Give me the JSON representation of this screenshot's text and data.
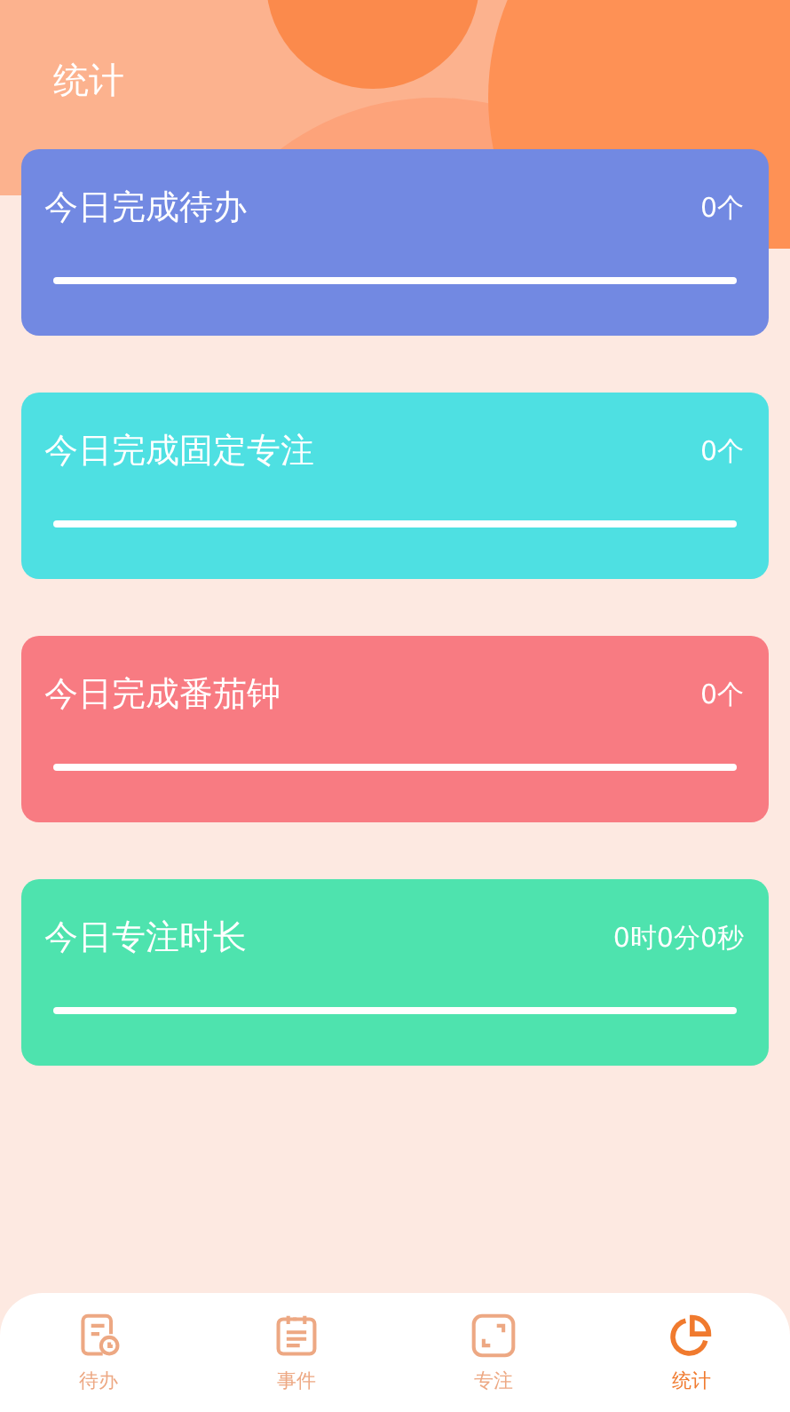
{
  "header": {
    "title": "统计"
  },
  "cards": [
    {
      "label": "今日完成待办",
      "value": "0个",
      "color": "#7289e2"
    },
    {
      "label": "今日完成固定专注",
      "value": "0个",
      "color": "#4ee0e2"
    },
    {
      "label": "今日完成番茄钟",
      "value": "0个",
      "color": "#f87b82"
    },
    {
      "label": "今日专注时长",
      "value": "0时0分0秒",
      "color": "#4ee3ae"
    }
  ],
  "tabbar": [
    {
      "label": "待办",
      "kind": "todo",
      "selected": false
    },
    {
      "label": "事件",
      "kind": "event",
      "selected": false
    },
    {
      "label": "专注",
      "kind": "focus",
      "selected": false
    },
    {
      "label": "统计",
      "kind": "stats",
      "selected": true
    }
  ]
}
